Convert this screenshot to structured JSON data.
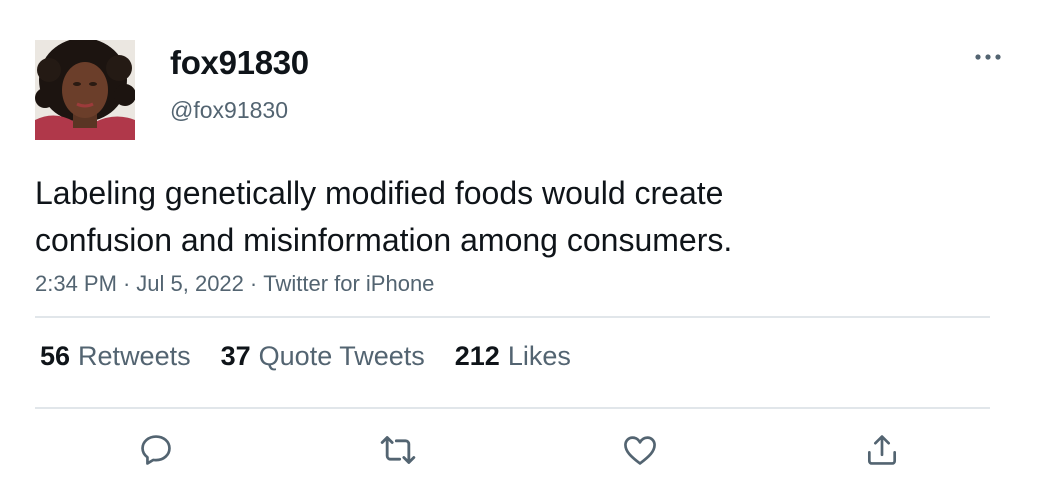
{
  "user": {
    "display_name": "fox91830",
    "handle": "@fox91830"
  },
  "tweet": {
    "text_line1": "Labeling genetically modified foods would create",
    "text_line2": "confusion and misinformation among consumers.",
    "time": "2:34 PM",
    "date": "Jul 5, 2022",
    "source": "Twitter for iPhone",
    "separator": "·"
  },
  "stats": {
    "retweets_count": "56",
    "retweets_label": "Retweets",
    "quotes_count": "37",
    "quotes_label": "Quote Tweets",
    "likes_count": "212",
    "likes_label": "Likes"
  },
  "actions": [
    "reply-icon",
    "retweet-icon",
    "like-icon",
    "share-icon"
  ],
  "colors": {
    "text_primary": "#0f1419",
    "text_secondary": "#536471",
    "divider": "#e1e6ea"
  }
}
